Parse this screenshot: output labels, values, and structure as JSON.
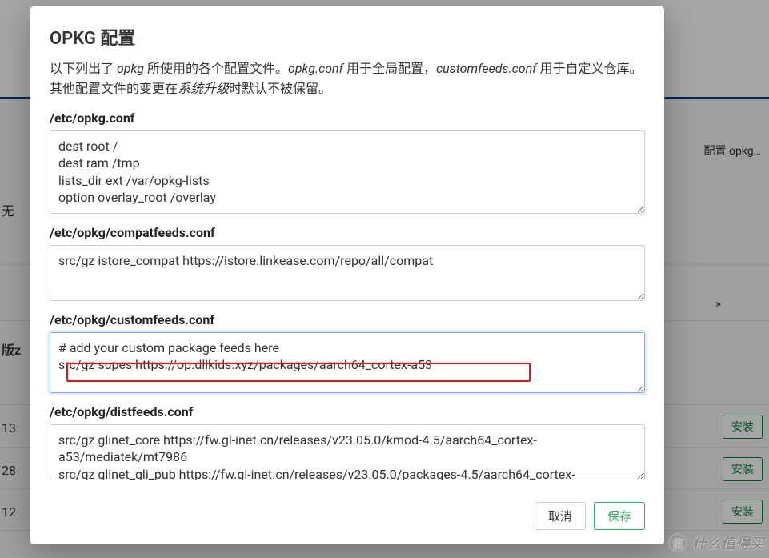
{
  "background": {
    "config_chip": "配置 opkg…",
    "none_text": "无",
    "version_label": "版z",
    "paginate": "»",
    "rows": [
      {
        "num": "13"
      },
      {
        "num": "28"
      },
      {
        "num": "12"
      }
    ],
    "install_label": "安装"
  },
  "modal": {
    "title": "OPKG 配置",
    "desc_prefix": "以下列出了 ",
    "desc_opkg_em": "opkg",
    "desc_mid1": " 所使用的各个配置文件。",
    "desc_opkgconf_em": "opkg.conf",
    "desc_mid2": " 用于全局配置，",
    "desc_custom_em": "customfeeds.conf",
    "desc_mid3": " 用于自定义仓库。其他配置文件的变更在",
    "desc_upgrade_em": "系统升级",
    "desc_suffix": "时默认不被保留。",
    "sections": {
      "opkg": {
        "label": "/etc/opkg.conf",
        "value": "dest root /\ndest ram /tmp\nlists_dir ext /var/opkg-lists\noption overlay_root /overlay"
      },
      "compat": {
        "label": "/etc/opkg/compatfeeds.conf",
        "value": "src/gz istore_compat https://istore.linkease.com/repo/all/compat"
      },
      "custom": {
        "label": "/etc/opkg/customfeeds.conf",
        "value": "# add your custom package feeds here\nsrc/gz supes https://op.dllkids.xyz/packages/aarch64_cortex-a53"
      },
      "dist": {
        "label": "/etc/opkg/distfeeds.conf",
        "value": "src/gz glinet_core https://fw.gl-inet.cn/releases/v23.05.0/kmod-4.5/aarch64_cortex-a53/mediatek/mt7986\nsrc/gz glinet_gli_pub https://fw.gl-inet.cn/releases/v23.05.0/packages-4.5/aarch64_cortex-"
      }
    },
    "buttons": {
      "cancel": "取消",
      "save": "保存"
    }
  },
  "watermark": {
    "text": "什么值得买",
    "icon": "值"
  }
}
